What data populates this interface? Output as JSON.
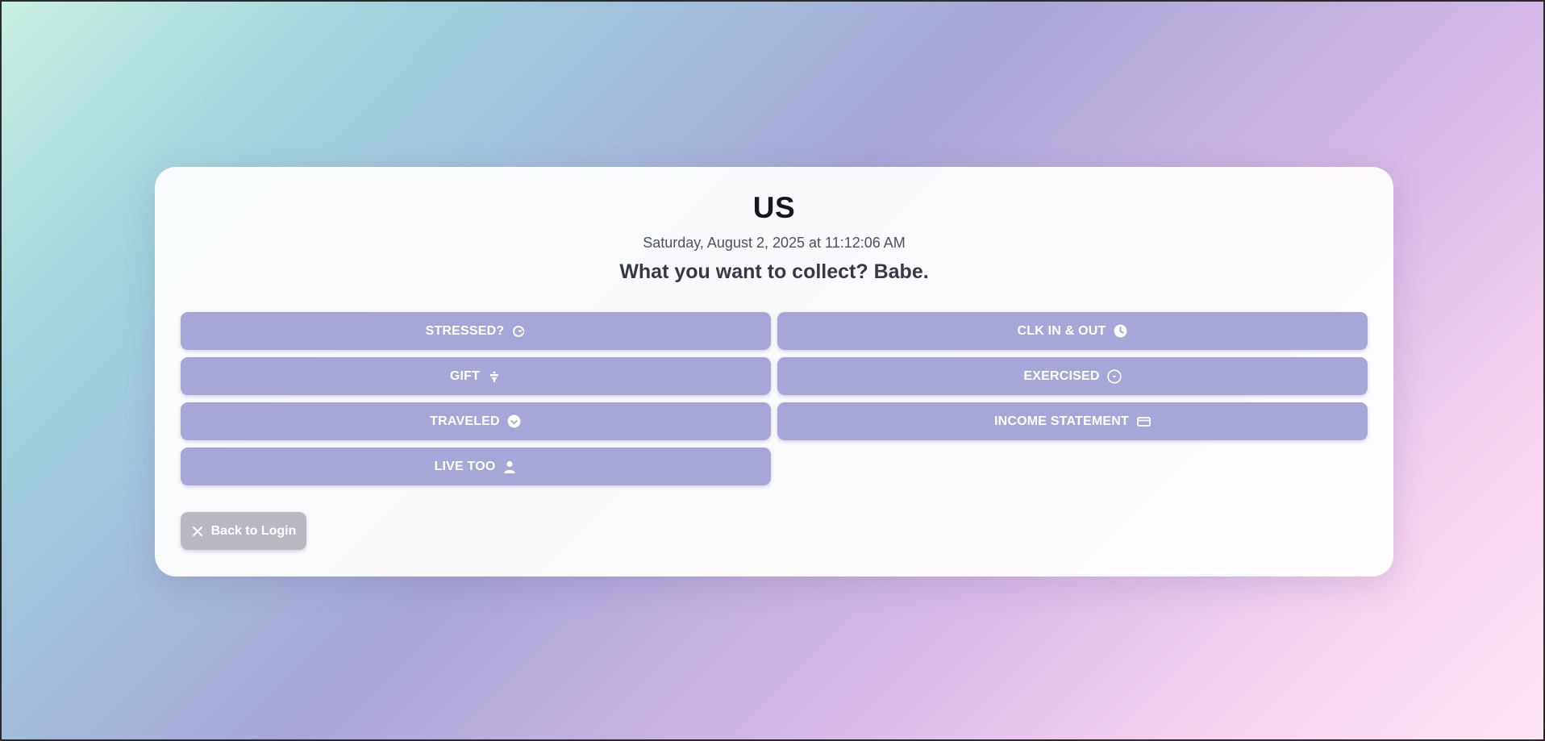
{
  "app": {
    "title": "US",
    "datetime": "Saturday, August 2, 2025 at 11:12:06 AM",
    "prompt": "What you want to collect? Babe."
  },
  "options": [
    {
      "label": "STRESSED?",
      "icon": "refresh-circle-icon"
    },
    {
      "label": "CLK IN & OUT",
      "icon": "clock-icon"
    },
    {
      "label": "GIFT",
      "icon": "gift-icon"
    },
    {
      "label": "EXERCISED",
      "icon": "circle-chevron-down-icon"
    },
    {
      "label": "TRAVELED",
      "icon": "check-circle-icon"
    },
    {
      "label": "INCOME STATEMENT",
      "icon": "card-icon"
    },
    {
      "label": "LIVE TOO",
      "icon": "user-icon"
    }
  ],
  "back": {
    "label": "Back to Login",
    "icon": "close-icon"
  },
  "colors": {
    "button": "#a6a7d8",
    "back_button": "#b9b8c2",
    "title": "#141821"
  }
}
